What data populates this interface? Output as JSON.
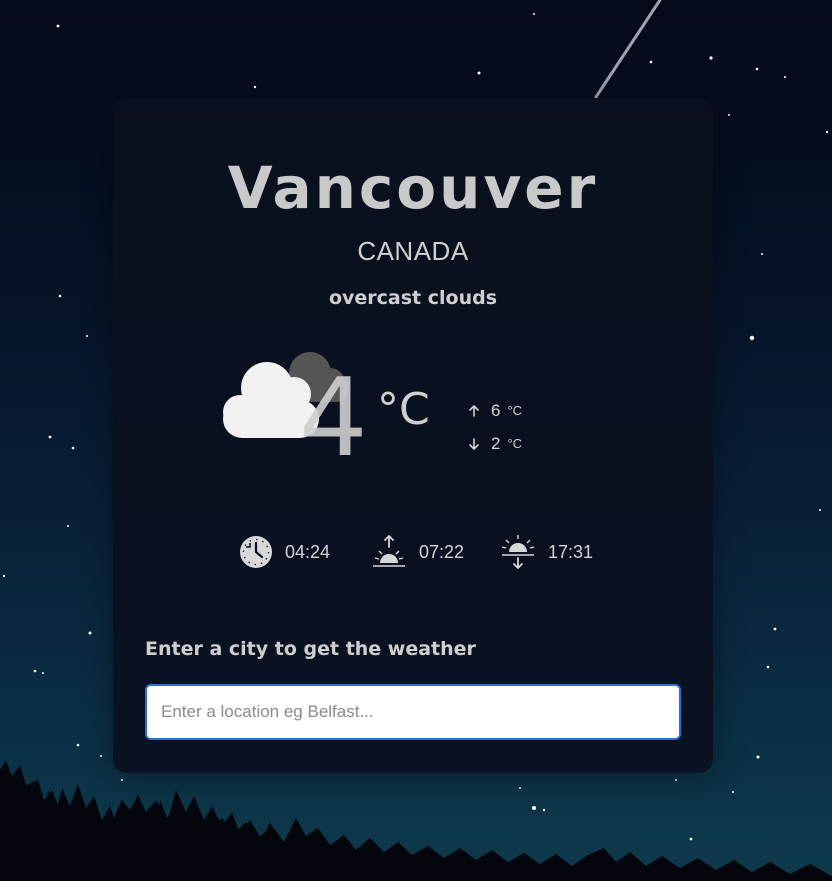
{
  "location": {
    "city": "Vancouver",
    "country": "CANADA",
    "description": "overcast clouds"
  },
  "current": {
    "icon": "overcast-clouds-icon",
    "temperature": "4",
    "unit": "°C",
    "high": "6",
    "low": "2",
    "minmax_unit": "°C"
  },
  "times": {
    "local_time": "04:24",
    "sunrise": "07:22",
    "sunset": "17:31"
  },
  "search": {
    "prompt": "Enter a city to get the weather",
    "placeholder": "Enter a location eg Belfast...",
    "value": ""
  },
  "colors": {
    "card_bg": "#0a101e",
    "text": "#cfcfcf",
    "input_border": "#2c6fd4"
  }
}
